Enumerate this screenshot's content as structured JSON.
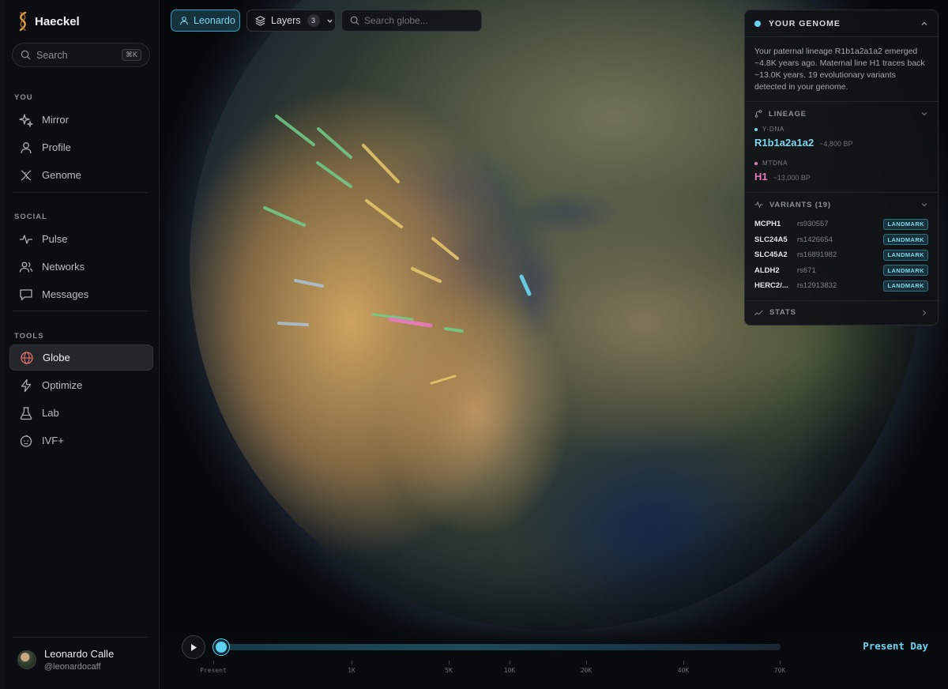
{
  "app": {
    "brand": "Haeckel"
  },
  "sidebar": {
    "search_placeholder": "Search",
    "search_shortcut": "⌘K",
    "sections": {
      "you": "YOU",
      "social": "SOCIAL",
      "tools": "TOOLS"
    },
    "items": [
      {
        "label": "Mirror",
        "icon": "sparkles-icon"
      },
      {
        "label": "Profile",
        "icon": "user-icon"
      },
      {
        "label": "Genome",
        "icon": "dna-icon"
      },
      {
        "label": "Pulse",
        "icon": "pulse-icon"
      },
      {
        "label": "Networks",
        "icon": "people-icon"
      },
      {
        "label": "Messages",
        "icon": "chat-icon"
      },
      {
        "label": "Globe",
        "icon": "globe-icon",
        "active": true
      },
      {
        "label": "Optimize",
        "icon": "bolt-icon"
      },
      {
        "label": "Lab",
        "icon": "flask-icon"
      },
      {
        "label": "IVF+",
        "icon": "baby-icon"
      }
    ],
    "user": {
      "name": "Leonardo Calle",
      "handle": "@leonardocaff"
    }
  },
  "toolbar": {
    "user_pill": "Leonardo",
    "layers_label": "Layers",
    "layers_count": "3",
    "search_placeholder": "Search globe..."
  },
  "genome_panel": {
    "title": "YOUR GENOME",
    "description": "Your paternal lineage R1b1a2a1a2 emerged ~4.8K years ago. Maternal line H1 traces back ~13.0K years. 19 evolutionary variants detected in your genome.",
    "lineage": {
      "title": "LINEAGE",
      "ydna_label": "Y-DNA",
      "ydna_value": "R1b1a2a1a2",
      "ydna_age": "~4,800 BP",
      "mtdna_label": "MTDNA",
      "mtdna_value": "H1",
      "mtdna_age": "~13,000 BP"
    },
    "variants": {
      "title": "VARIANTS (19)",
      "rows": [
        {
          "gene": "MCPH1",
          "rs": "rs930557",
          "tag": "LANDMARK"
        },
        {
          "gene": "SLC24A5",
          "rs": "rs1426654",
          "tag": "LANDMARK"
        },
        {
          "gene": "SLC45A2",
          "rs": "rs16891982",
          "tag": "LANDMARK"
        },
        {
          "gene": "ALDH2",
          "rs": "rs671",
          "tag": "LANDMARK"
        },
        {
          "gene": "HERC2/...",
          "rs": "rs12913832",
          "tag": "LANDMARK"
        }
      ]
    },
    "stats_title": "STATS"
  },
  "timeline": {
    "ticks": [
      "Present",
      "1K",
      "5K",
      "10K",
      "20K",
      "40K",
      "70K"
    ],
    "current_label": "Present Day",
    "progress": 0
  },
  "colors": {
    "accent": "#64d4f0",
    "ydna": "#7fd6ee",
    "mtdna": "#e57bb8",
    "landmark_tag": "#7fd6ee"
  }
}
